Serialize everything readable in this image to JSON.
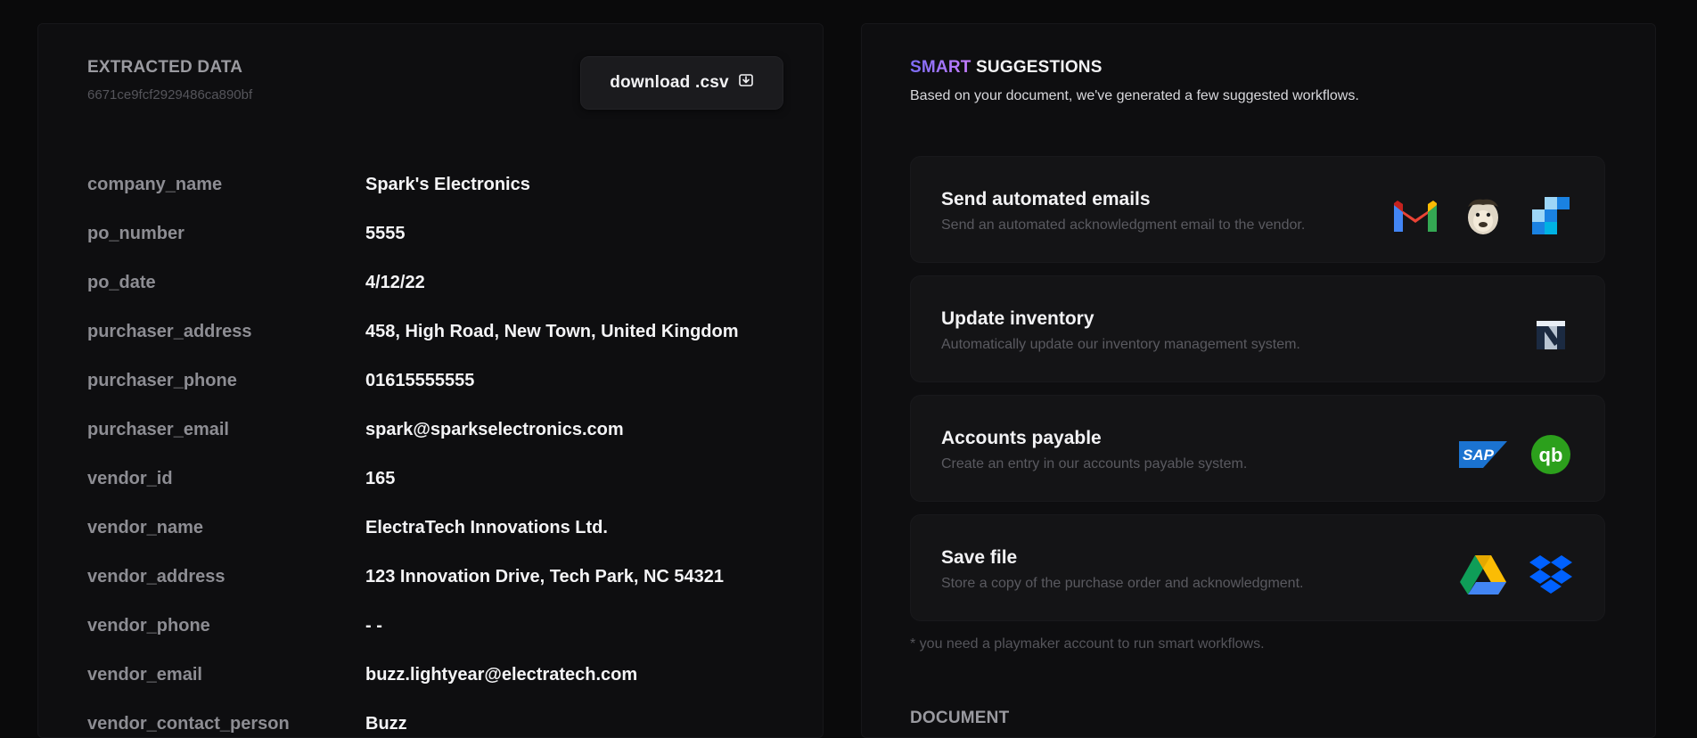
{
  "extracted": {
    "title": "EXTRACTED DATA",
    "doc_id": "6671ce9fcf2929486ca890bf",
    "download_label": "download .csv",
    "fields": [
      {
        "key": "company_name",
        "value": "Spark's Electronics"
      },
      {
        "key": "po_number",
        "value": "5555"
      },
      {
        "key": "po_date",
        "value": "4/12/22"
      },
      {
        "key": "purchaser_address",
        "value": "458, High Road, New Town, United Kingdom"
      },
      {
        "key": "purchaser_phone",
        "value": "01615555555"
      },
      {
        "key": "purchaser_email",
        "value": "spark@sparkselectronics.com"
      },
      {
        "key": "vendor_id",
        "value": "165"
      },
      {
        "key": "vendor_name",
        "value": "ElectraTech Innovations Ltd."
      },
      {
        "key": "vendor_address",
        "value": "123 Innovation Drive, Tech Park, NC 54321"
      },
      {
        "key": "vendor_phone",
        "value": "- -"
      },
      {
        "key": "vendor_email",
        "value": "buzz.lightyear@electratech.com"
      },
      {
        "key": "vendor_contact_person",
        "value": "Buzz"
      }
    ]
  },
  "smart": {
    "title_accent": "SMART",
    "title_rest": "SUGGESTIONS",
    "subtitle": "Based on your document, we've generated a few suggested workflows.",
    "workflows": [
      {
        "title": "Send automated emails",
        "desc": "Send an automated acknowledgment email to the vendor.",
        "icons": [
          "gmail-icon",
          "mailchimp-icon",
          "sendgrid-icon"
        ]
      },
      {
        "title": "Update inventory",
        "desc": "Automatically update our inventory management system.",
        "icons": [
          "netsuite-icon"
        ]
      },
      {
        "title": "Accounts payable",
        "desc": "Create an entry in our accounts payable system.",
        "icons": [
          "sap-icon",
          "quickbooks-icon"
        ]
      },
      {
        "title": "Save file",
        "desc": "Store a copy of the purchase order and acknowledgment.",
        "icons": [
          "google-drive-icon",
          "dropbox-icon"
        ]
      }
    ],
    "note": "* you need a playmaker account to run smart workflows."
  },
  "document": {
    "title": "DOCUMENT"
  },
  "colors": {
    "accent_start": "#7b6cf6",
    "accent_end": "#c77dff",
    "background": "#0a0a0b"
  }
}
